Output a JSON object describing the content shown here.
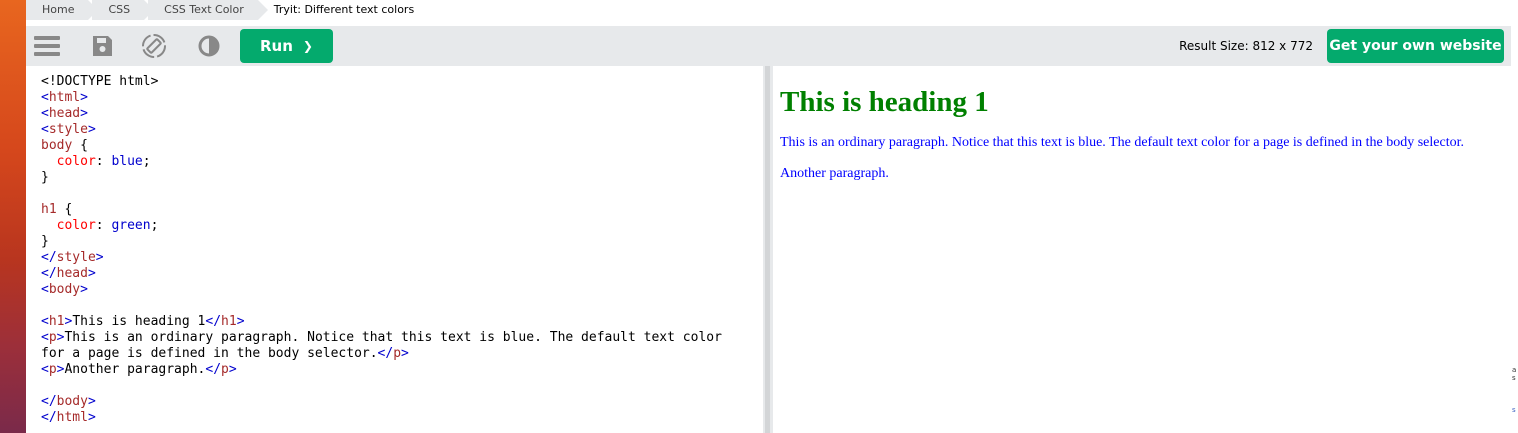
{
  "breadcrumb": {
    "items": [
      "Home",
      "CSS",
      "CSS Text Color"
    ],
    "current": "Tryit: Different text colors"
  },
  "toolbar": {
    "icons": [
      "menu-icon",
      "save-icon",
      "rotate-icon",
      "contrast-icon"
    ],
    "run_label": "Run",
    "run_chevron": "❯",
    "result_size": "Result Size: 812 x 772",
    "get_website_label": "Get your own website",
    "accent_color": "#04aa6d"
  },
  "code": {
    "lines": [
      [
        [
          "txt",
          "<!DOCTYPE html>"
        ]
      ],
      [
        [
          "br",
          "<"
        ],
        [
          "tag",
          "html"
        ],
        [
          "br",
          ">"
        ]
      ],
      [
        [
          "br",
          "<"
        ],
        [
          "tag",
          "head"
        ],
        [
          "br",
          ">"
        ]
      ],
      [
        [
          "br",
          "<"
        ],
        [
          "tag",
          "style"
        ],
        [
          "br",
          ">"
        ]
      ],
      [
        [
          "sel",
          "body "
        ],
        [
          "txt",
          "{"
        ]
      ],
      [
        [
          "txt",
          "  "
        ],
        [
          "prop",
          "color"
        ],
        [
          "txt",
          ": "
        ],
        [
          "val",
          "blue"
        ],
        [
          "txt",
          ";"
        ]
      ],
      [
        [
          "txt",
          "}"
        ]
      ],
      [
        [
          "txt",
          ""
        ]
      ],
      [
        [
          "sel",
          "h1 "
        ],
        [
          "txt",
          "{"
        ]
      ],
      [
        [
          "txt",
          "  "
        ],
        [
          "prop",
          "color"
        ],
        [
          "txt",
          ": "
        ],
        [
          "val",
          "green"
        ],
        [
          "txt",
          ";"
        ]
      ],
      [
        [
          "txt",
          "}"
        ]
      ],
      [
        [
          "br",
          "</"
        ],
        [
          "tag",
          "style"
        ],
        [
          "br",
          ">"
        ]
      ],
      [
        [
          "br",
          "</"
        ],
        [
          "tag",
          "head"
        ],
        [
          "br",
          ">"
        ]
      ],
      [
        [
          "br",
          "<"
        ],
        [
          "tag",
          "body"
        ],
        [
          "br",
          ">"
        ]
      ],
      [
        [
          "txt",
          ""
        ]
      ],
      [
        [
          "br",
          "<"
        ],
        [
          "tag",
          "h1"
        ],
        [
          "br",
          ">"
        ],
        [
          "txt",
          "This is heading 1"
        ],
        [
          "br",
          "</"
        ],
        [
          "tag",
          "h1"
        ],
        [
          "br",
          ">"
        ]
      ],
      [
        [
          "br",
          "<"
        ],
        [
          "tag",
          "p"
        ],
        [
          "br",
          ">"
        ],
        [
          "txt",
          "This is an ordinary paragraph. Notice that this text is blue. The default text color"
        ]
      ],
      [
        [
          "txt",
          "for a page is defined in the body selector."
        ],
        [
          "br",
          "</"
        ],
        [
          "tag",
          "p"
        ],
        [
          "br",
          ">"
        ]
      ],
      [
        [
          "br",
          "<"
        ],
        [
          "tag",
          "p"
        ],
        [
          "br",
          ">"
        ],
        [
          "txt",
          "Another paragraph."
        ],
        [
          "br",
          "</"
        ],
        [
          "tag",
          "p"
        ],
        [
          "br",
          ">"
        ]
      ],
      [
        [
          "txt",
          ""
        ]
      ],
      [
        [
          "br",
          "</"
        ],
        [
          "tag",
          "body"
        ],
        [
          "br",
          ">"
        ]
      ],
      [
        [
          "br",
          "</"
        ],
        [
          "tag",
          "html"
        ],
        [
          "br",
          ">"
        ]
      ]
    ]
  },
  "result": {
    "heading": "This is heading 1",
    "paragraph1": "This is an ordinary paragraph. Notice that this text is blue. The default text color for a page is defined in the body selector.",
    "paragraph2": "Another paragraph.",
    "heading_color": "green",
    "text_color": "blue"
  }
}
